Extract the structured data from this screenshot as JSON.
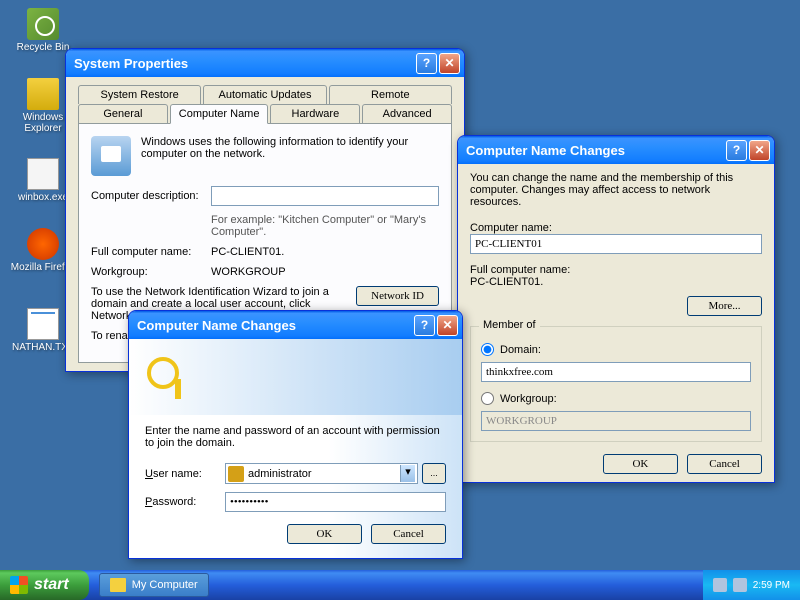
{
  "desktop": {
    "icons": [
      {
        "label": "Recycle Bin"
      },
      {
        "label": "Windows Explorer"
      },
      {
        "label": "winbox.exe"
      },
      {
        "label": "Mozilla Firefox"
      },
      {
        "label": "NATHAN.TXT"
      }
    ]
  },
  "sysprops": {
    "title": "System Properties",
    "tabs_top": [
      "System Restore",
      "Automatic Updates",
      "Remote"
    ],
    "tabs_bottom": [
      "General",
      "Computer Name",
      "Hardware",
      "Advanced"
    ],
    "intro": "Windows uses the following information to identify your computer on the network.",
    "desc_label": "Computer description:",
    "desc_value": "",
    "example": "For example: \"Kitchen Computer\" or \"Mary's Computer\".",
    "fullname_label": "Full computer name:",
    "fullname_value": "PC-CLIENT01.",
    "workgroup_label": "Workgroup:",
    "workgroup_value": "WORKGROUP",
    "wizard_text": "To use the Network Identification Wizard to join a domain and create a local user account, click Network ID.",
    "network_id_btn": "Network ID",
    "rename_text": "To rename this computer or join a domain, click Change."
  },
  "namechanges": {
    "title": "Computer Name Changes",
    "intro": "You can change the name and the membership of this computer. Changes may affect access to network resources.",
    "name_label": "Computer name:",
    "name_value": "PC-CLIENT01",
    "fullname_label": "Full computer name:",
    "fullname_value": "PC-CLIENT01.",
    "more_btn": "More...",
    "group_title": "Member of",
    "domain_label": "Domain:",
    "domain_value": "thinkxfree.com",
    "workgroup_label": "Workgroup:",
    "workgroup_value": "WORKGROUP",
    "ok": "OK",
    "cancel": "Cancel"
  },
  "auth": {
    "title": "Computer Name Changes",
    "prompt": "Enter the name and password of an account with permission to join the domain.",
    "user_label": "User name:",
    "user_value": "administrator",
    "pass_label": "Password:",
    "pass_value": "••••••••••",
    "ok": "OK",
    "cancel": "Cancel"
  },
  "taskbar": {
    "start": "start",
    "task": "My Computer",
    "clock": "2:59 PM"
  }
}
